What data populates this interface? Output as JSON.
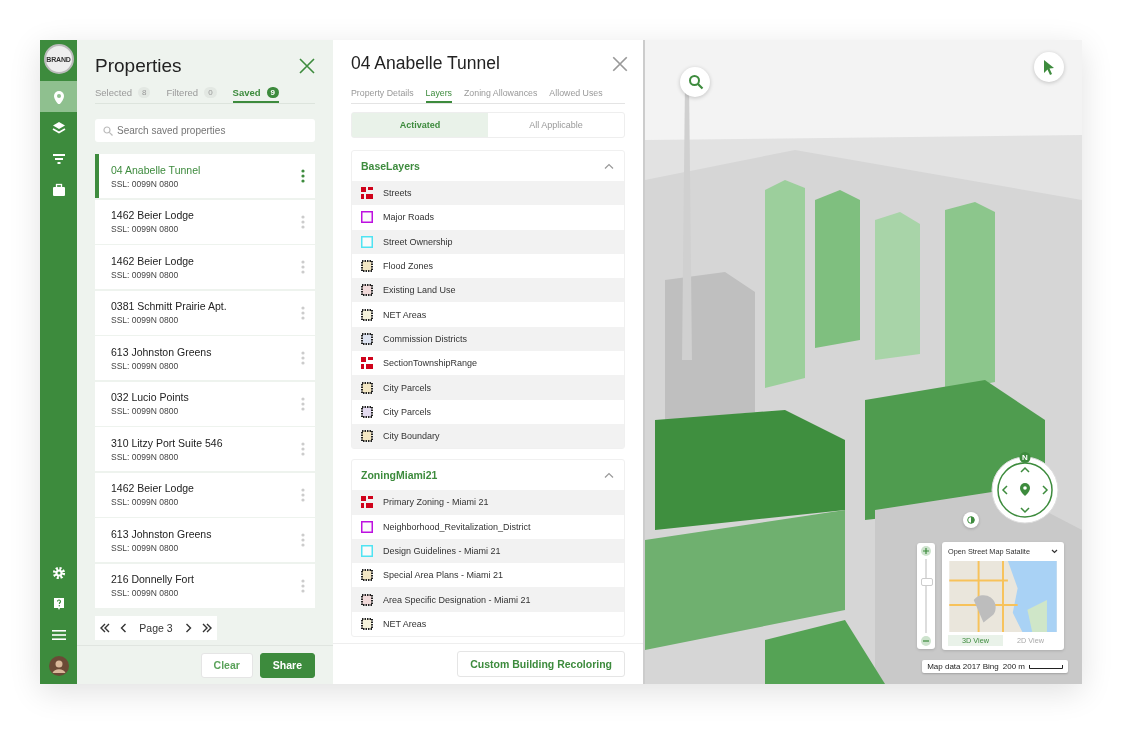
{
  "brand": "BRAND",
  "nav": {
    "items": [
      {
        "selected": true
      },
      {
        "selected": false
      },
      {
        "selected": false
      },
      {
        "selected": false
      }
    ]
  },
  "properties": {
    "title": "Properties",
    "tabs": [
      {
        "label": "Selected",
        "count": "8",
        "selected": false
      },
      {
        "label": "Filtered",
        "count": "0",
        "selected": false
      },
      {
        "label": "Saved",
        "count": "9",
        "selected": true
      }
    ],
    "search": {
      "placeholder": "Search saved properties"
    },
    "items": [
      {
        "name": "04 Anabelle Tunnel",
        "ssl": "SSL: 0099N 0800",
        "selected": true
      },
      {
        "name": "1462 Beier Lodge",
        "ssl": "SSL: 0099N 0800",
        "selected": false
      },
      {
        "name": "1462 Beier Lodge",
        "ssl": "SSL: 0099N 0800",
        "selected": false
      },
      {
        "name": "0381 Schmitt Prairie Apt.",
        "ssl": "SSL: 0099N 0800",
        "selected": false
      },
      {
        "name": "613 Johnston Greens",
        "ssl": "SSL: 0099N 0800",
        "selected": false
      },
      {
        "name": "032 Lucio Points",
        "ssl": "SSL: 0099N 0800",
        "selected": false
      },
      {
        "name": "310 Litzy Port Suite 546",
        "ssl": "SSL: 0099N 0800",
        "selected": false
      },
      {
        "name": "1462 Beier Lodge",
        "ssl": "SSL: 0099N 0800",
        "selected": false
      },
      {
        "name": "613 Johnston Greens",
        "ssl": "SSL: 0099N 0800",
        "selected": false
      },
      {
        "name": "216 Donnelly Fort",
        "ssl": "SSL: 0099N 0800",
        "selected": false
      }
    ],
    "pagination": {
      "label": "Page 3"
    },
    "buttons": [
      {
        "label": "Clear",
        "kind": "secondary"
      },
      {
        "label": "Share",
        "kind": "primary"
      }
    ]
  },
  "details": {
    "title": "04 Anabelle Tunnel",
    "tabs": [
      {
        "label": "Property Details",
        "selected": false
      },
      {
        "label": "Layers",
        "selected": true
      },
      {
        "label": "Zoning Allowances",
        "selected": false
      },
      {
        "label": "Allowed Uses",
        "selected": false
      }
    ],
    "segments": [
      {
        "label": "Activated",
        "selected": true
      },
      {
        "label": "All Applicable",
        "selected": false
      }
    ],
    "groups": [
      {
        "title": "BaseLayers",
        "expanded": true,
        "layers": [
          {
            "name": "Streets",
            "kind": "blocks",
            "color": "#d0021b"
          },
          {
            "name": "Major Roads",
            "kind": "outline",
            "color": "#bd10e0"
          },
          {
            "name": "Street Ownership",
            "kind": "outline",
            "color": "#50e3f2"
          },
          {
            "name": "Flood Zones",
            "kind": "dotted",
            "color": "#f3e7c4"
          },
          {
            "name": "Existing Land Use",
            "kind": "dotted",
            "color": "#f1dada"
          },
          {
            "name": "NET Areas",
            "kind": "dotted",
            "color": "#f6f3dc"
          },
          {
            "name": "Commission Districts",
            "kind": "dotted",
            "color": "#dde3f1"
          },
          {
            "name": "SectionTownshipRange",
            "kind": "blocks",
            "color": "#d0021b"
          },
          {
            "name": "City Parcels",
            "kind": "dotted",
            "color": "#f3e7c4"
          },
          {
            "name": "City Parcels",
            "kind": "dotted",
            "color": "#e5dcf1"
          },
          {
            "name": "City Boundary",
            "kind": "dotted",
            "color": "#f3e7c4"
          }
        ]
      },
      {
        "title": "ZoningMiami21",
        "expanded": true,
        "layers": [
          {
            "name": "Primary Zoning - Miami 21",
            "kind": "blocks",
            "color": "#d0021b"
          },
          {
            "name": "Neighborhood_Revitalization_District",
            "kind": "outline",
            "color": "#bd10e0"
          },
          {
            "name": "Design Guidelines - Miami 21",
            "kind": "outline",
            "color": "#50e3f2"
          },
          {
            "name": "Special Area Plans - Miami 21",
            "kind": "dotted",
            "color": "#f3e7c4"
          },
          {
            "name": "Area Specific Designation - Miami 21",
            "kind": "dotted",
            "color": "#f1dada"
          },
          {
            "name": "NET Areas",
            "kind": "dotted",
            "color": "#f6f3dc"
          }
        ]
      }
    ],
    "footer_button": "Custom Building Recoloring"
  },
  "map": {
    "compass": {
      "north": "N"
    },
    "zoom": {
      "level": 0.7
    },
    "basemap": {
      "label": "Open Street Map Satalite",
      "views": [
        {
          "label": "3D View",
          "selected": true
        },
        {
          "label": "2D View",
          "selected": false
        }
      ]
    },
    "scale": {
      "attribution": "Map data 2017 Bing",
      "distance": "200 m"
    }
  }
}
